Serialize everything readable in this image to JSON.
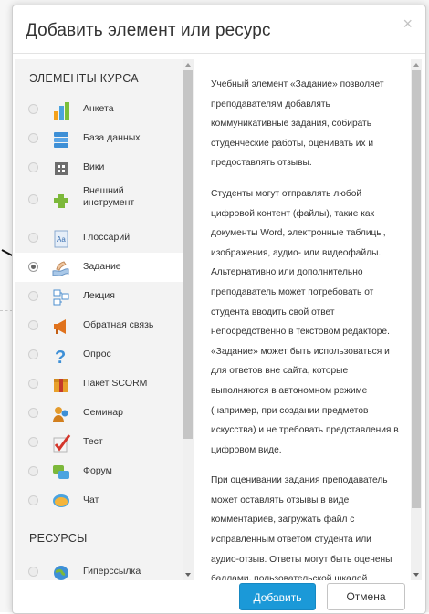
{
  "dialog": {
    "title": "Добавить элемент или ресурс",
    "close_icon": "close-icon"
  },
  "sections": {
    "activities": "ЭЛЕМЕНТЫ КУРСА",
    "resources": "РЕСУРСЫ"
  },
  "items": [
    {
      "label": "Анкета",
      "icon": "survey-icon",
      "selected": false
    },
    {
      "label": "База данных",
      "icon": "database-icon",
      "selected": false
    },
    {
      "label": "Вики",
      "icon": "wiki-icon",
      "selected": false
    },
    {
      "label": "Внешний инструмент",
      "icon": "external-tool-icon",
      "selected": false
    },
    {
      "label": "Глоссарий",
      "icon": "glossary-icon",
      "selected": false
    },
    {
      "label": "Задание",
      "icon": "assignment-icon",
      "selected": true
    },
    {
      "label": "Лекция",
      "icon": "lesson-icon",
      "selected": false
    },
    {
      "label": "Обратная связь",
      "icon": "feedback-icon",
      "selected": false
    },
    {
      "label": "Опрос",
      "icon": "choice-icon",
      "selected": false
    },
    {
      "label": "Пакет SCORM",
      "icon": "scorm-icon",
      "selected": false
    },
    {
      "label": "Семинар",
      "icon": "workshop-icon",
      "selected": false
    },
    {
      "label": "Тест",
      "icon": "quiz-icon",
      "selected": false
    },
    {
      "label": "Форум",
      "icon": "forum-icon",
      "selected": false
    },
    {
      "label": "Чат",
      "icon": "chat-icon",
      "selected": false
    }
  ],
  "resource_items": [
    {
      "label": "Гиперссылка",
      "icon": "url-icon",
      "selected": false
    }
  ],
  "description": {
    "p1": "Учебный элемент «Задание» позволяет преподавателям добавлять коммуникативные задания, собирать студенческие работы, оценивать их и предоставлять отзывы.",
    "p2": "Студенты могут отправлять любой цифровой контент (файлы), такие как документы Word, электронные таблицы, изображения, аудио- или видеофайлы. Альтернативно или дополнительно преподаватель может потребовать от студента вводить свой ответ непосредственно в текстовом редакторе. «Задание» может быть использоваться и для ответов вне сайта, которые выполняются в автономном режиме (например, при создании предметов искусства) и не требовать представления в цифровом виде.",
    "p3": "При оценивании задания преподаватель может оставлять отзывы в виде комментариев, загружать файл с исправленным ответом студента или аудио-отзыв. Ответы могут быть оценены баллами, пользовательской шкалой оценивания или «продвинутыми» методами, такими как рубрики. Итоговая"
  },
  "buttons": {
    "add": "Добавить",
    "cancel": "Отмена"
  },
  "colors": {
    "primary": "#1b99d8",
    "list_bg": "#f3f3f3"
  }
}
